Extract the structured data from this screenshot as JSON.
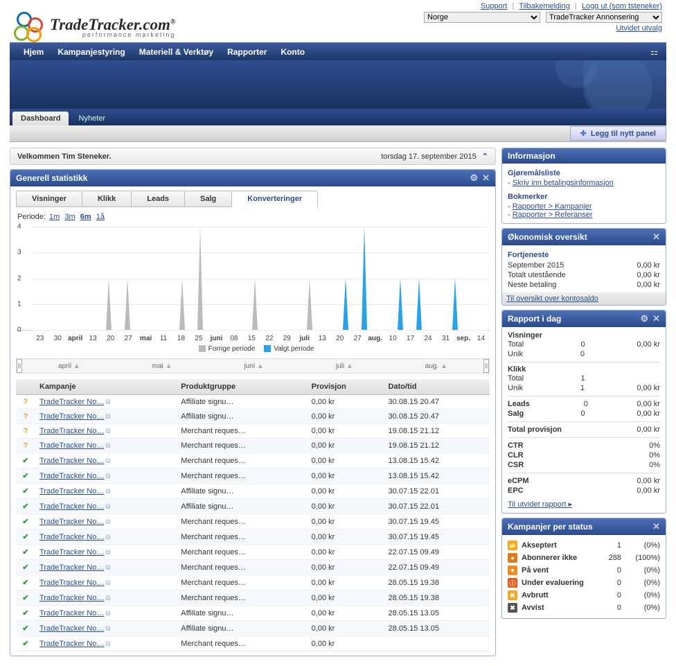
{
  "top_links": {
    "support": "Support",
    "feedback": "Tilbakemelding",
    "logout": "Logg ut (som tsteneker)"
  },
  "brand": {
    "name": "TradeTracker.com",
    "sup": "®",
    "tag": "performance marketing"
  },
  "selects": {
    "country": "Norge",
    "product": "TradeTracker Annonsering",
    "utvidet": "Utvidet utvalg"
  },
  "nav": [
    "Hjem",
    "Kampanjestyring",
    "Materiell & Verktøy",
    "Rapporter",
    "Konto"
  ],
  "tabs": {
    "dashboard": "Dashboard",
    "nyheter": "Nyheter"
  },
  "add_panel": "Legg til nytt panel",
  "welcome": {
    "text": "Velkommen Tim Steneker.",
    "date": "torsdag 17. september 2015"
  },
  "stats": {
    "title": "Generell statistikk",
    "tabs": [
      "Visninger",
      "Klikk",
      "Leads",
      "Salg",
      "Konverteringer"
    ],
    "active_tab": 4,
    "periode_label": "Periode:",
    "periods": [
      "1m",
      "3m",
      "6m",
      "1å"
    ],
    "period_sel": 2,
    "legend": {
      "prev": "Forrige periode",
      "sel": "Valgt periode"
    },
    "slider_months": [
      "april",
      "mai",
      "juni",
      "juli",
      "aug."
    ],
    "table_headers": [
      "Kampanje",
      "Produktgruppe",
      "Provisjon",
      "Dato/tid"
    ],
    "rows": [
      {
        "s": "q",
        "k": "TradeTracker No…",
        "p": "Affiliate signu…",
        "pr": "0,00 kr",
        "d": "30.08.15 20.47"
      },
      {
        "s": "q",
        "k": "TradeTracker No…",
        "p": "Affiliate signu…",
        "pr": "0,00 kr",
        "d": "30.08.15 20.47"
      },
      {
        "s": "q",
        "k": "TradeTracker No…",
        "p": "Merchant reques…",
        "pr": "0,00 kr",
        "d": "19.08.15 21.12"
      },
      {
        "s": "q",
        "k": "TradeTracker No…",
        "p": "Merchant reques…",
        "pr": "0,00 kr",
        "d": "19.08.15 21.12"
      },
      {
        "s": "ok",
        "k": "TradeTracker No…",
        "p": "Merchant reques…",
        "pr": "0,00 kr",
        "d": "13.08.15 15.42"
      },
      {
        "s": "ok",
        "k": "TradeTracker No…",
        "p": "Merchant reques…",
        "pr": "0,00 kr",
        "d": "13.08.15 15.42"
      },
      {
        "s": "ok",
        "k": "TradeTracker No…",
        "p": "Affiliate signu…",
        "pr": "0,00 kr",
        "d": "30.07.15 22.01"
      },
      {
        "s": "ok",
        "k": "TradeTracker No…",
        "p": "Affiliate signu…",
        "pr": "0,00 kr",
        "d": "30.07.15 22.01"
      },
      {
        "s": "ok",
        "k": "TradeTracker No…",
        "p": "Merchant reques…",
        "pr": "0,00 kr",
        "d": "30.07.15 19.45"
      },
      {
        "s": "ok",
        "k": "TradeTracker No…",
        "p": "Merchant reques…",
        "pr": "0,00 kr",
        "d": "30.07.15 19.45"
      },
      {
        "s": "ok",
        "k": "TradeTracker No…",
        "p": "Merchant reques…",
        "pr": "0,00 kr",
        "d": "22.07.15 09.49"
      },
      {
        "s": "ok",
        "k": "TradeTracker No…",
        "p": "Merchant reques…",
        "pr": "0,00 kr",
        "d": "22.07.15 09.49"
      },
      {
        "s": "ok",
        "k": "TradeTracker No…",
        "p": "Merchant reques…",
        "pr": "0,00 kr",
        "d": "28.05.15 19.38"
      },
      {
        "s": "ok",
        "k": "TradeTracker No…",
        "p": "Merchant reques…",
        "pr": "0,00 kr",
        "d": "28.05.15 19.38"
      },
      {
        "s": "ok",
        "k": "TradeTracker No…",
        "p": "Affiliate signu…",
        "pr": "0,00 kr",
        "d": "28.05.15 13.05"
      },
      {
        "s": "ok",
        "k": "TradeTracker No…",
        "p": "Affiliate signu…",
        "pr": "0,00 kr",
        "d": "28.05.15 13.05"
      },
      {
        "s": "ok",
        "k": "TradeTracker No…",
        "p": "Merchant reques…",
        "pr": "0,00 kr",
        "d": ""
      }
    ]
  },
  "chart_data": {
    "type": "line",
    "ylim": [
      0,
      4
    ],
    "yticks": [
      0,
      1,
      2,
      3,
      4
    ],
    "xticks": [
      "23",
      "30",
      "april",
      "13",
      "20",
      "27",
      "mai",
      "11",
      "18",
      "25",
      "juni",
      "08",
      "15",
      "22",
      "29",
      "juli",
      "13",
      "20",
      "27",
      "aug.",
      "10",
      "17",
      "24",
      "31",
      "sep.",
      "14"
    ],
    "series": [
      {
        "name": "Forrige periode",
        "color": "#bbb",
        "spikes": [
          {
            "x": 4,
            "v": 2
          },
          {
            "x": 5,
            "v": 2
          },
          {
            "x": 8,
            "v": 2
          },
          {
            "x": 9,
            "v": 4
          },
          {
            "x": 12,
            "v": 2
          },
          {
            "x": 15,
            "v": 2
          },
          {
            "x": 17,
            "v": 2
          }
        ]
      },
      {
        "name": "Valgt periode",
        "color": "#2aa3e6",
        "spikes": [
          {
            "x": 17,
            "v": 2
          },
          {
            "x": 18,
            "v": 4
          },
          {
            "x": 20,
            "v": 2
          },
          {
            "x": 21,
            "v": 2
          },
          {
            "x": 23,
            "v": 2
          }
        ]
      }
    ]
  },
  "info": {
    "title": "Informasjon",
    "todo_h": "Gjøremålsliste",
    "todo_items": [
      "Skriv inn betalingsinformasjon"
    ],
    "book_h": "Bokmerker",
    "book_items": [
      "Rapporter > Kampanjer",
      "Rapporter > Referanser"
    ]
  },
  "econ": {
    "title": "Økonomisk oversikt",
    "fort_h": "Fortjeneste",
    "rows": [
      {
        "l": "September 2015",
        "v": "0,00 kr"
      },
      {
        "l": "Totalt utestående",
        "v": "0,00 kr"
      },
      {
        "l": "Neste betaling",
        "v": "0,00 kr"
      }
    ],
    "saldo": "Til oversikt over kontosaldo"
  },
  "report": {
    "title": "Rapport i dag",
    "visn_h": "Visninger",
    "visn": [
      {
        "l": "Total",
        "c": "0",
        "v": "0,00 kr"
      },
      {
        "l": "Unik",
        "c": "0",
        "v": ""
      }
    ],
    "klikk_h": "Klikk",
    "klikk": [
      {
        "l": "Total",
        "c": "1",
        "v": ""
      },
      {
        "l": "Unik",
        "c": "1",
        "v": "0,00 kr"
      }
    ],
    "leads": {
      "l": "Leads",
      "c": "0",
      "v": "0,00 kr"
    },
    "salg": {
      "l": "Salg",
      "c": "0",
      "v": "0,00 kr"
    },
    "totprov": {
      "l": "Total provisjon",
      "v": "0,00 kr"
    },
    "ratios": [
      {
        "l": "CTR",
        "v": "0%"
      },
      {
        "l": "CLR",
        "v": "0%"
      },
      {
        "l": "CSR",
        "v": "0%"
      }
    ],
    "ext": [
      {
        "l": "eCPM",
        "v": "0,00 kr"
      },
      {
        "l": "EPC",
        "v": "0,00 kr"
      }
    ],
    "link": "Til utvidet rapport"
  },
  "camp": {
    "title": "Kampanjer per status",
    "rows": [
      {
        "ic": "📁",
        "c": "#f5a623",
        "l": "Akseptert",
        "n": "1",
        "p": "(0%)"
      },
      {
        "ic": "●",
        "c": "#e07a1a",
        "l": "Abonnerer ikke",
        "n": "288",
        "p": "(100%)"
      },
      {
        "ic": "⏸",
        "c": "#f08a24",
        "l": "På vent",
        "n": "0",
        "p": "(0%)"
      },
      {
        "ic": "ⓘ",
        "c": "#e85a1a",
        "l": "Under evaluering",
        "n": "0",
        "p": "(0%)"
      },
      {
        "ic": "✖",
        "c": "#f5a623",
        "l": "Avbrutt",
        "n": "0",
        "p": "(0%)"
      },
      {
        "ic": "✖",
        "c": "#555",
        "l": "Avvist",
        "n": "0",
        "p": "(0%)"
      }
    ]
  }
}
